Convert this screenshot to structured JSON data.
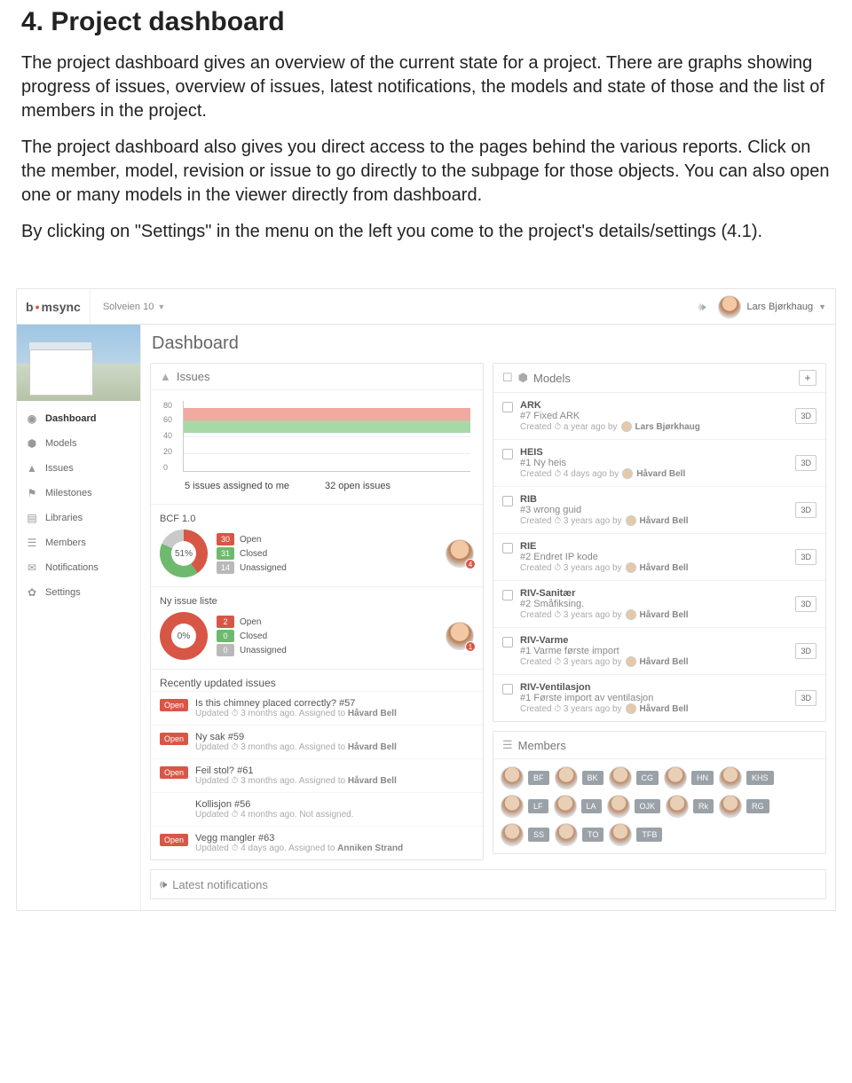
{
  "doc": {
    "heading": "4. Project dashboard",
    "p1": "The project dashboard gives an overview of the current state for a project. There are graphs showing progress of issues, overview of issues, latest notifications, the models and state of those and the list of members in the project.",
    "p2": "The project dashboard also gives you direct access to the pages behind the various reports. Click on the member, model, revision or issue to go directly to the subpage for those objects. You can also open one or many models in the viewer directly from dashboard.",
    "p3": "By clicking on \"Settings\" in the menu on the left you come to the project's details/settings (4.1)."
  },
  "app": {
    "logo_pre": "b",
    "logo_accent": "•",
    "logo_post": "msync",
    "project_name": "Solveien 10",
    "user_name": "Lars Bjørkhaug",
    "page_title": "Dashboard",
    "nav": [
      {
        "icon": "◉",
        "label": "Dashboard",
        "active": true
      },
      {
        "icon": "⬢",
        "label": "Models"
      },
      {
        "icon": "▲",
        "label": "Issues"
      },
      {
        "icon": "⚑",
        "label": "Milestones"
      },
      {
        "icon": "▤",
        "label": "Libraries"
      },
      {
        "icon": "☰",
        "label": "Members"
      },
      {
        "icon": "✉",
        "label": "Notifications"
      },
      {
        "icon": "✿",
        "label": "Settings"
      }
    ],
    "issues_panel_title": "Issues",
    "models_panel_title": "Models",
    "members_panel_title": "Members",
    "latest_title": "Latest notifications",
    "issue_stats": {
      "assigned": "5 issues assigned to me",
      "open": "32 open issues"
    },
    "boards": [
      {
        "title": "BCF 1.0",
        "pct": "51%",
        "open": 30,
        "closed": 31,
        "unassigned": 14,
        "avatar_badge": "4",
        "donut_css": "conic-gradient(#d85645 0 144deg,#6fb96f 144deg 294deg,#c9c9c9 294deg 360deg)"
      },
      {
        "title": "Ny issue liste",
        "pct": "0%",
        "open": 2,
        "closed": 0,
        "unassigned": 0,
        "avatar_badge": "1",
        "donut_css": "conic-gradient(#d85645 0 360deg)"
      }
    ],
    "legend_labels": {
      "open": "Open",
      "closed": "Closed",
      "unassigned": "Unassigned"
    },
    "recent_title": "Recently updated issues",
    "recent": [
      {
        "status": "Open",
        "title": "Is this chimney placed correctly? #57",
        "sub_pre": "Updated ⏱ 3 months ago. Assigned to ",
        "sub_b": "Håvard Bell"
      },
      {
        "status": "Open",
        "title": "Ny sak #59",
        "sub_pre": "Updated ⏱ 3 months ago. Assigned to ",
        "sub_b": "Håvard Bell"
      },
      {
        "status": "Open",
        "title": "Feil stol? #61",
        "sub_pre": "Updated ⏱ 3 months ago. Assigned to ",
        "sub_b": "Håvard Bell"
      },
      {
        "status": "",
        "title": "Kollisjon #56",
        "sub_pre": "Updated ⏱ 4 months ago. Not assigned.",
        "sub_b": ""
      },
      {
        "status": "Open",
        "title": "Vegg mangler #63",
        "sub_pre": "Updated ⏱ 4 days ago. Assigned to ",
        "sub_b": "Anniken Strand"
      }
    ],
    "btn3d_label": "3D",
    "models": [
      {
        "name": "ARK",
        "rev": "#7 Fixed ARK",
        "meta_pre": "Created ⏱ a year ago by ",
        "meta_b": "Lars Bjørkhaug"
      },
      {
        "name": "HEIS",
        "rev": "#1 Ny heis",
        "meta_pre": "Created ⏱ 4 days ago by ",
        "meta_b": "Håvard Bell"
      },
      {
        "name": "RIB",
        "rev": "#3 wrong guid",
        "meta_pre": "Created ⏱ 3 years ago by ",
        "meta_b": "Håvard Bell"
      },
      {
        "name": "RIE",
        "rev": "#2 Endret IP kode",
        "meta_pre": "Created ⏱ 3 years ago by ",
        "meta_b": "Håvard Bell"
      },
      {
        "name": "RIV-Sanitær",
        "rev": "#2 Småfiksing.",
        "meta_pre": "Created ⏱ 3 years ago by ",
        "meta_b": "Håvard Bell"
      },
      {
        "name": "RIV-Varme",
        "rev": "#1 Varme første import",
        "meta_pre": "Created ⏱ 3 years ago by ",
        "meta_b": "Håvard Bell"
      },
      {
        "name": "RIV-Ventilasjon",
        "rev": "#1 Første import av ventilasjon",
        "meta_pre": "Created ⏱ 3 years ago by ",
        "meta_b": "Håvard Bell"
      }
    ],
    "members": [
      "BF",
      "BK",
      "CG",
      "HN",
      "KHS",
      "LF",
      "LA",
      "OJK",
      "Rk",
      "RG",
      "SS",
      "TO",
      "TFB"
    ]
  },
  "chart_data": {
    "type": "area",
    "title": "Issues",
    "ylim": [
      0,
      80
    ],
    "yticks": [
      0,
      20,
      40,
      60,
      80
    ],
    "series": [
      {
        "name": "Open (red band)",
        "approx_value": 58
      },
      {
        "name": "Closed (green band)",
        "approx_value": 44
      }
    ],
    "note": "Stacked bands across time; x-axis ticks not labeled in screenshot."
  }
}
